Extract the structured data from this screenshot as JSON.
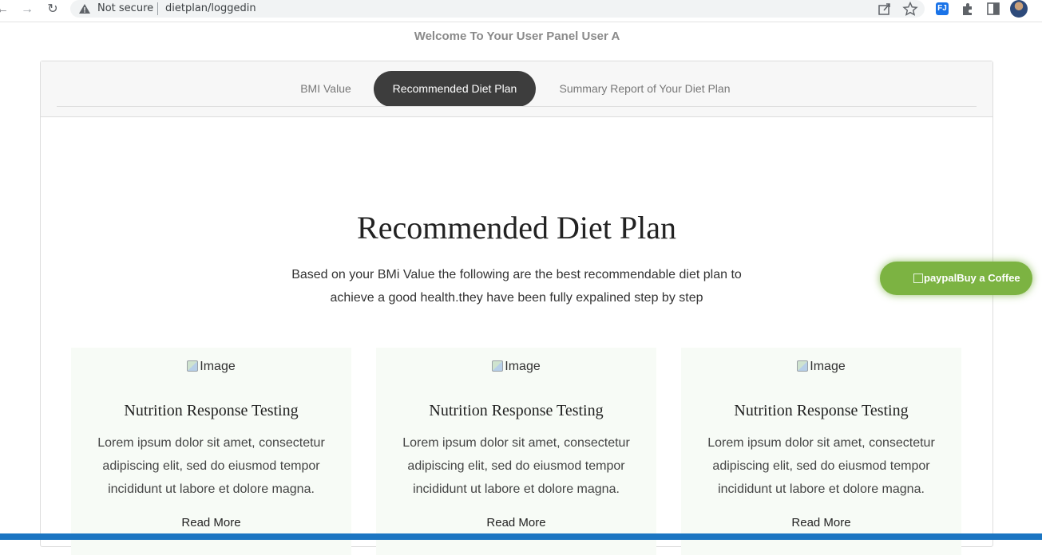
{
  "browser": {
    "back_glyph": "←",
    "forward_glyph": "→",
    "reload_glyph": "↻",
    "security_label": "Not secure",
    "url": "dietplan/loggedin",
    "ext_label": "FJ"
  },
  "header": {
    "welcome": "Welcome To Your User Panel User A"
  },
  "tabs": [
    {
      "label": "BMI Value",
      "active": false
    },
    {
      "label": "Recommended Diet Plan",
      "active": true
    },
    {
      "label": "Summary Report of Your Diet Plan",
      "active": false
    }
  ],
  "section": {
    "title": "Recommended Diet Plan",
    "subtitle": "Based on your BMi Value the following are the best recommendable diet plan to achieve a good health.they have been fully expalined step by step"
  },
  "cards": [
    {
      "image_alt": "Image",
      "title": "Nutrition Response Testing",
      "text": "Lorem ipsum dolor sit amet, consectetur adipiscing elit, sed do eiusmod tempor incididunt ut labore et dolore magna.",
      "link": "Read More"
    },
    {
      "image_alt": "Image",
      "title": "Nutrition Response Testing",
      "text": "Lorem ipsum dolor sit amet, consectetur adipiscing elit, sed do eiusmod tempor incididunt ut labore et dolore magna.",
      "link": "Read More"
    },
    {
      "image_alt": "Image",
      "title": "Nutrition Response Testing",
      "text": "Lorem ipsum dolor sit amet, consectetur adipiscing elit, sed do eiusmod tempor incididunt ut labore et dolore magna.",
      "link": "Read More"
    }
  ],
  "coffee_button": {
    "icon_alt": "paypal",
    "label": "Buy a Coffee"
  },
  "colors": {
    "active_tab": "#3d3d3d",
    "coffee_green": "#7cb342",
    "card_bg": "#f7fbf6",
    "statusbar": "#1b75c2"
  }
}
